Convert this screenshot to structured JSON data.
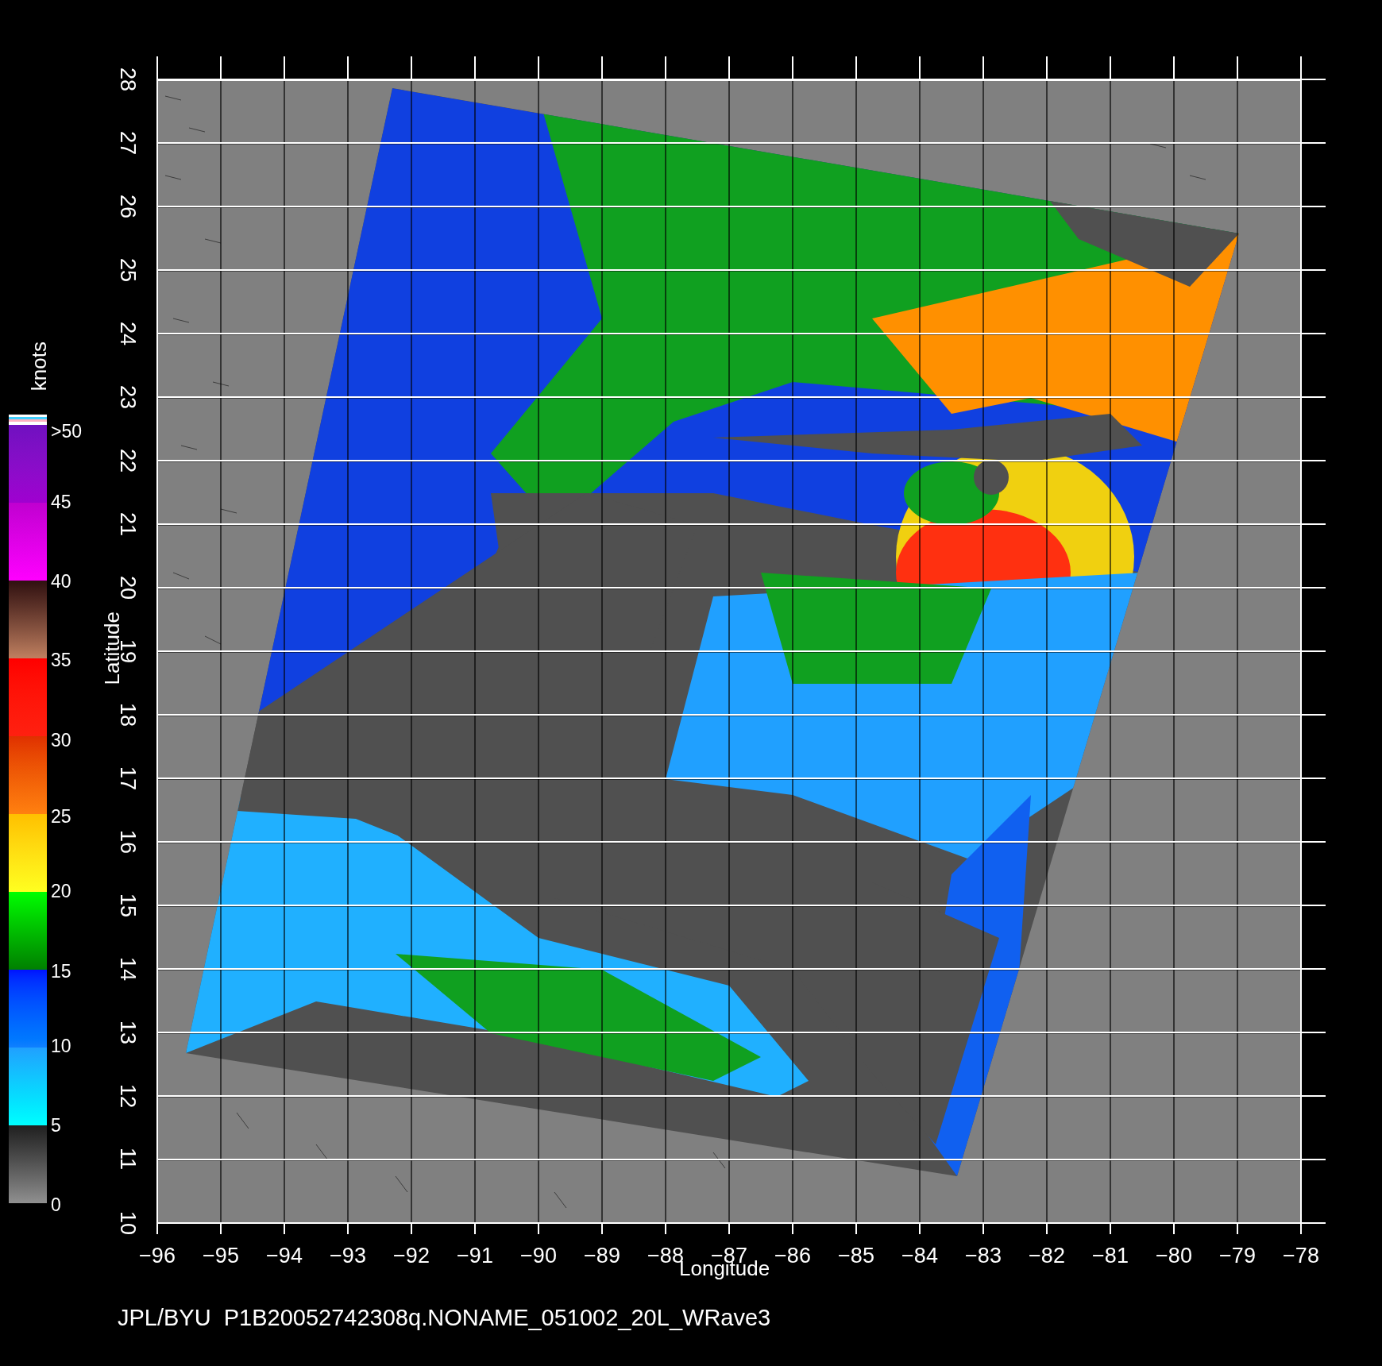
{
  "map": {
    "x_ticks": [
      "−96",
      "−95",
      "−94",
      "−93",
      "−92",
      "−91",
      "−90",
      "−89",
      "−88",
      "−87",
      "−86",
      "−85",
      "−84",
      "−83",
      "−82",
      "−81",
      "−80",
      "−79",
      "−78"
    ],
    "y_ticks": [
      "10",
      "11",
      "12",
      "13",
      "14",
      "15",
      "16",
      "17",
      "18",
      "19",
      "20",
      "21",
      "22",
      "23",
      "24",
      "25",
      "26",
      "27",
      "28"
    ],
    "xlabel": "Longitude",
    "ylabel": "Latitude"
  },
  "colorbar": {
    "title": "knots",
    "labels": [
      ">50",
      "45",
      "40",
      "35",
      "30",
      "25",
      "20",
      "15",
      "10",
      "5",
      "0"
    ]
  },
  "footer": "JPL/BYU  P1B20052742308q.NONAME_051002_20L_WRave3"
}
